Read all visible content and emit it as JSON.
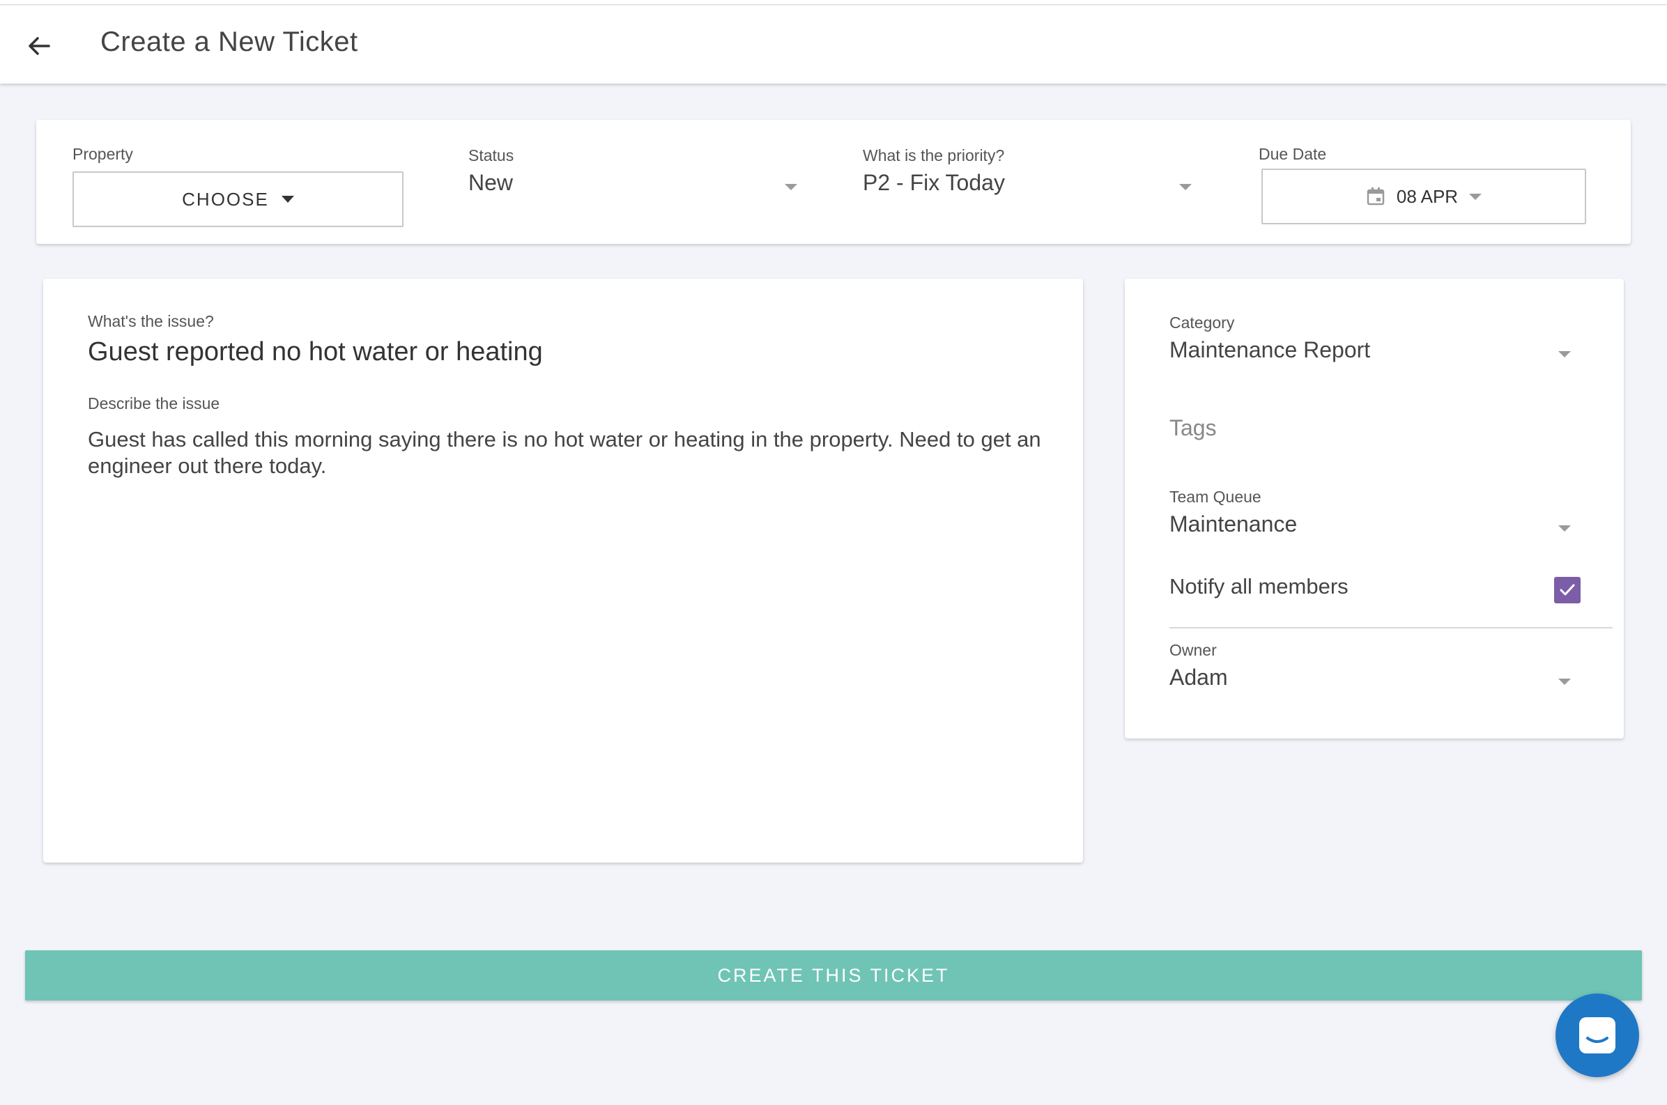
{
  "header": {
    "title": "Create a New Ticket",
    "back_icon": "arrow-left-icon"
  },
  "fields": {
    "property": {
      "label": "Property",
      "button_label": "CHOOSE"
    },
    "status": {
      "label": "Status",
      "value": "New"
    },
    "priority": {
      "label": "What is the priority?",
      "value": "P2 - Fix Today"
    },
    "due_date": {
      "label": "Due Date",
      "value": "08 APR",
      "icon": "calendar-icon"
    }
  },
  "issue": {
    "title_label": "What's the issue?",
    "title_value": "Guest reported no hot water or heating",
    "desc_label": "Describe the issue",
    "desc_value": "Guest has called this morning saying there is no hot water or heating in the property.  Need to get an engineer out there today."
  },
  "side": {
    "category": {
      "label": "Category",
      "value": "Maintenance Report"
    },
    "tags": {
      "placeholder": "Tags"
    },
    "team_queue": {
      "label": "Team Queue",
      "value": "Maintenance"
    },
    "notify": {
      "label": "Notify all members",
      "checked": true
    },
    "owner": {
      "label": "Owner",
      "value": "Adam"
    }
  },
  "actions": {
    "create_label": "CREATE THIS TICKET"
  },
  "colors": {
    "accent": "#6fc4b6",
    "checkbox": "#7b5ea7",
    "chat": "#1f78c6",
    "background": "#f2f4fa"
  }
}
